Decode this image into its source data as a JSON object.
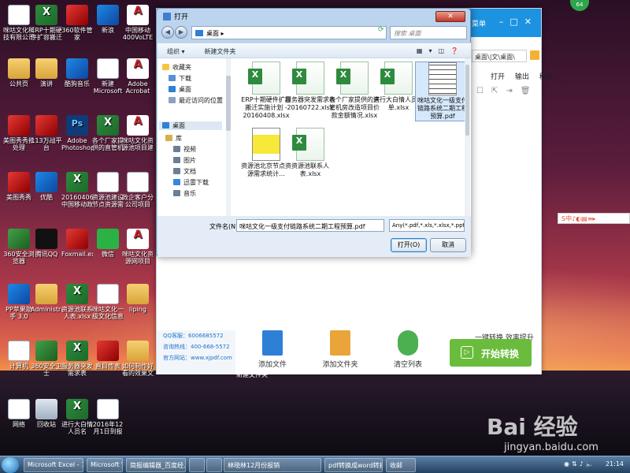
{
  "desktop": {
    "icons": [
      {
        "label": "咪咕文化科技有限公司采购",
        "type": "doc"
      },
      {
        "label": "ERP十期硬件扩容搬迁实...",
        "type": "excel"
      },
      {
        "label": "360软件管家",
        "type": "red"
      },
      {
        "label": "新浪",
        "type": "blue"
      },
      {
        "label": "中国移动400VoLTE改造...",
        "type": "pdf"
      },
      {
        "label": "公共页",
        "type": "folder"
      },
      {
        "label": "演讲",
        "type": "folder"
      },
      {
        "label": "酷狗音乐",
        "type": "blue"
      },
      {
        "label": "新建 Microsoft ...",
        "type": "doc"
      },
      {
        "label": "Adobe Acrobat ...",
        "type": "pdf"
      },
      {
        "label": "美图秀秀批处理",
        "type": "red"
      },
      {
        "label": "113万战平台",
        "type": "red"
      },
      {
        "label": "Adobe Photoshop",
        "type": "ps"
      },
      {
        "label": "各个厂家提供的直管机房改...",
        "type": "excel"
      },
      {
        "label": "咪咕文化资源池项目建工...",
        "type": "pdf"
      },
      {
        "label": "美图秀秀",
        "type": "red"
      },
      {
        "label": "优酷",
        "type": "blue"
      },
      {
        "label": "20160406中国移动政企...",
        "type": "excel"
      },
      {
        "label": "资源池建设节点资源需求...",
        "type": "doc"
      },
      {
        "label": "政企客户分公司项目组...",
        "type": "doc"
      },
      {
        "label": "360安全浏览器",
        "type": "green"
      },
      {
        "label": "腾讯QQ",
        "type": "penguin"
      },
      {
        "label": "Foxmail.exe",
        "type": "red"
      },
      {
        "label": "微信",
        "type": "wechat"
      },
      {
        "label": "咪咕文化资源网项目 201...",
        "type": "pdf"
      },
      {
        "label": "PP苹果助手 3.0",
        "type": "blue"
      },
      {
        "label": "Administrat...",
        "type": "folder"
      },
      {
        "label": "资源池联系人表.xlsx",
        "type": "excel"
      },
      {
        "label": "咪咕文化一级文化信息系...",
        "type": "doc"
      },
      {
        "label": "liping",
        "type": "folder"
      },
      {
        "label": "计算机",
        "type": "doc"
      },
      {
        "label": "360安全卫士",
        "type": "green"
      },
      {
        "label": "服务器突发需求表20160722...",
        "type": "excel"
      },
      {
        "label": "直目传表",
        "type": "red"
      },
      {
        "label": "如何制作好看的效果文字",
        "type": "folder"
      },
      {
        "label": "网络",
        "type": "doc"
      },
      {
        "label": "回收站",
        "type": "bin"
      },
      {
        "label": "进行大白情人员名单.xlsx",
        "type": "excel"
      },
      {
        "label": "2016年12月1日到报表...",
        "type": "doc"
      }
    ]
  },
  "app": {
    "menu_label": "菜单",
    "path": "桌面\\|文\\桌面\\",
    "columns": [
      "打开",
      "输出",
      "移除"
    ],
    "side_links": [
      "QQ客服：6006685572",
      "咨询热线：400-668-5572",
      "官方网站：www.xjpdf.com"
    ],
    "tools": [
      "添加文件",
      "添加文件夹",
      "清空列表"
    ],
    "convert_hint": "一键转换 效率提升",
    "convert_label": "开始转换",
    "new_folder_ghost": "新建文件夹"
  },
  "dialog": {
    "title": "打开",
    "close": "✕",
    "address": "桌面",
    "search_placeholder": "搜索 桌面",
    "organize": "组织 ▾",
    "new_folder": "新建文件夹",
    "nav": {
      "favorites": "收藏夹",
      "items": [
        {
          "label": "下载",
          "icon": "download-icon"
        },
        {
          "label": "桌面",
          "icon": "desktop-icon"
        },
        {
          "label": "最近访问的位置",
          "icon": "recent-icon"
        }
      ],
      "desktop": "桌面",
      "libraries": "库",
      "lib_items": [
        {
          "label": "视频",
          "icon": "video-icon"
        },
        {
          "label": "图片",
          "icon": "picture-icon"
        },
        {
          "label": "文档",
          "icon": "document-icon"
        },
        {
          "label": "迅雷下载",
          "icon": "thunder-icon"
        },
        {
          "label": "音乐",
          "icon": "music-icon"
        }
      ]
    },
    "files": [
      {
        "label": "ERP十期硬件扩容搬迁实施计划 - 20160408.xlsx",
        "kind": "xl"
      },
      {
        "label": "服务器突发需求表 20160722.xlsx",
        "kind": "xl"
      },
      {
        "label": "各个厂家提供的直管机房改造项目价款金额情况.xlsx",
        "kind": "xl"
      },
      {
        "label": "进行大白情人员名单.xlsx",
        "kind": "xl"
      },
      {
        "label": "咪咕文化一级支付链路系统二期工程预算.pdf",
        "kind": "pdf",
        "selected": true
      },
      {
        "label": "资源池北京节点资源需求统计...",
        "kind": "yellow"
      },
      {
        "label": "资源池联系人表.xlsx",
        "kind": "xl"
      }
    ],
    "filename_label": "文件名(N):",
    "filename_value": "咪咕文化一级支付链路系统二期工程预算.pdf",
    "filetype_value": "Any(*.pdf,*.xls,*.xlsx,*.ppt,*.pptx",
    "open_label": "打开(O)",
    "cancel_label": "取消"
  },
  "ime": "S中♪◐▤≡▸",
  "watermark": {
    "logo": "Bai 经验",
    "url": "jingyan.baidu.com",
    "badge": "64"
  },
  "taskbar": {
    "items": [
      "Microsoft Excel - 1...",
      "Microsoft Word",
      "简报编辑器_百度经...",
      "",
      "",
      "林晓林12月份报销",
      "pdf转换成word转换...",
      "收邮"
    ],
    "clock": "21:14"
  }
}
